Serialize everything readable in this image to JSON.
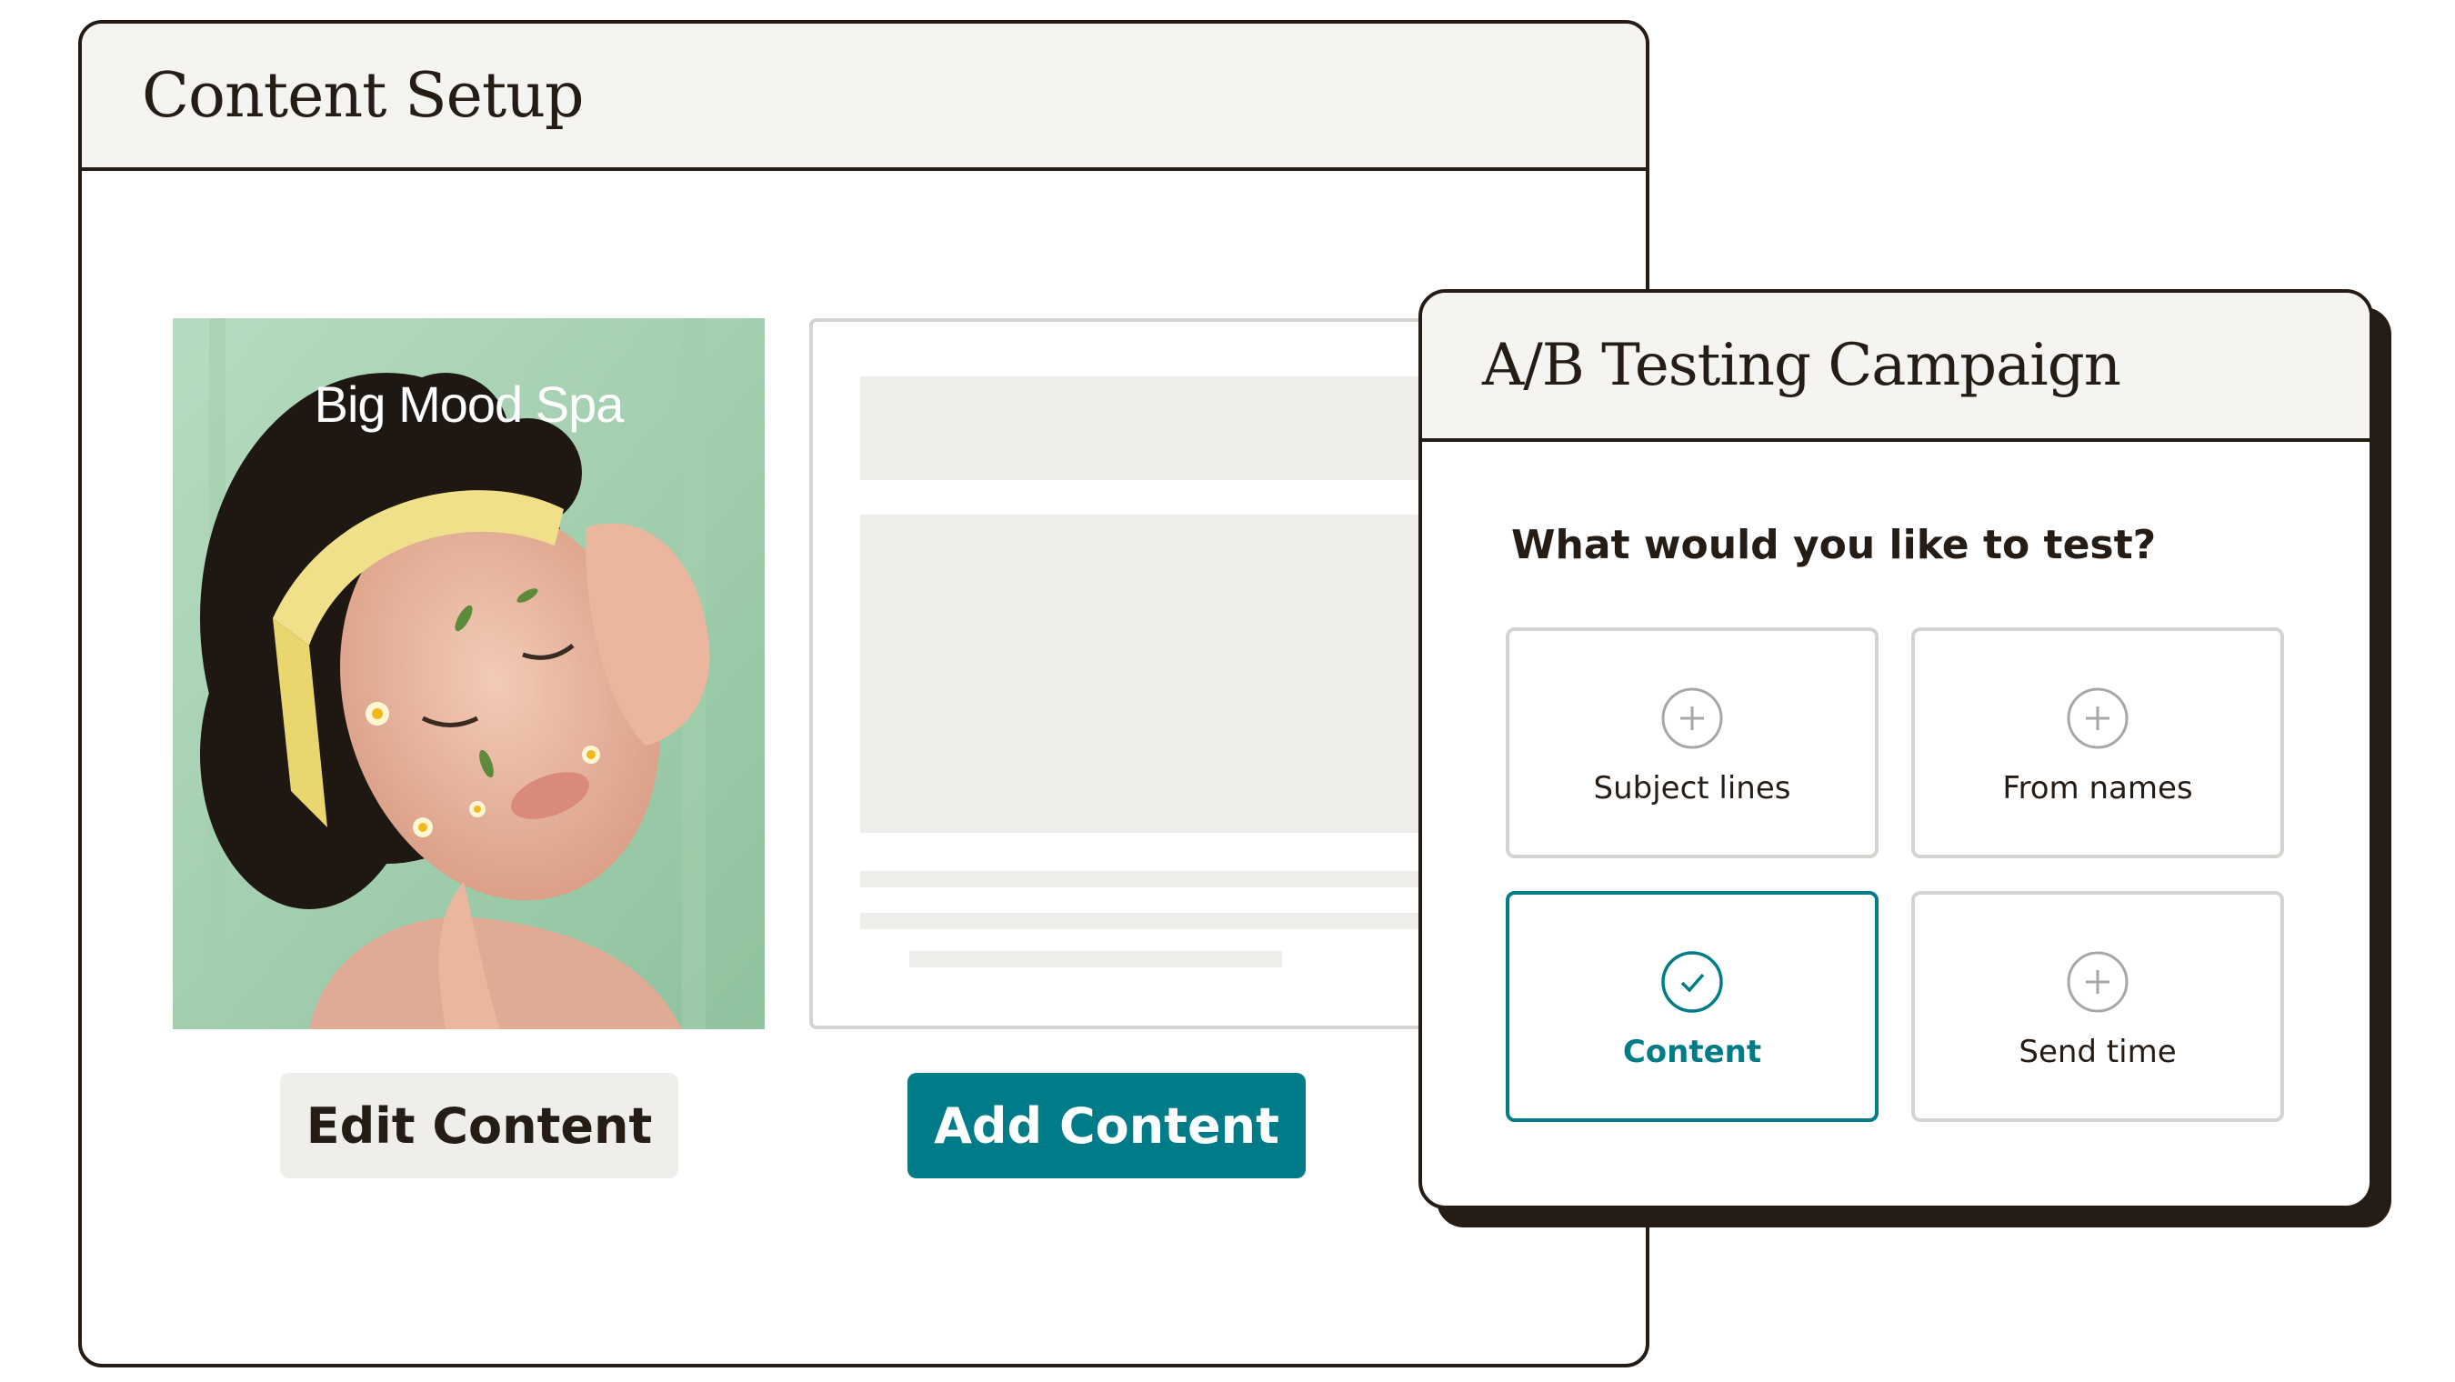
{
  "content_setup": {
    "title": "Content Setup",
    "photo_caption": "Big Mood Spa",
    "edit_button_label": "Edit Content",
    "add_button_label": "Add Content"
  },
  "ab_testing": {
    "title": "A/B Testing Campaign",
    "question": "What would you like to test?",
    "options": [
      {
        "label": "Subject lines",
        "icon": "plus-circle-icon",
        "selected": false
      },
      {
        "label": "From names",
        "icon": "plus-circle-icon",
        "selected": false
      },
      {
        "label": "Content",
        "icon": "check-circle-icon",
        "selected": true
      },
      {
        "label": "Send time",
        "icon": "plus-circle-icon",
        "selected": false
      }
    ]
  },
  "colors": {
    "ink": "#241c15",
    "accent": "#007c89",
    "neutral": "#efeeea",
    "header_bg": "#f5f4f0",
    "border_light": "#d4d3cf"
  }
}
